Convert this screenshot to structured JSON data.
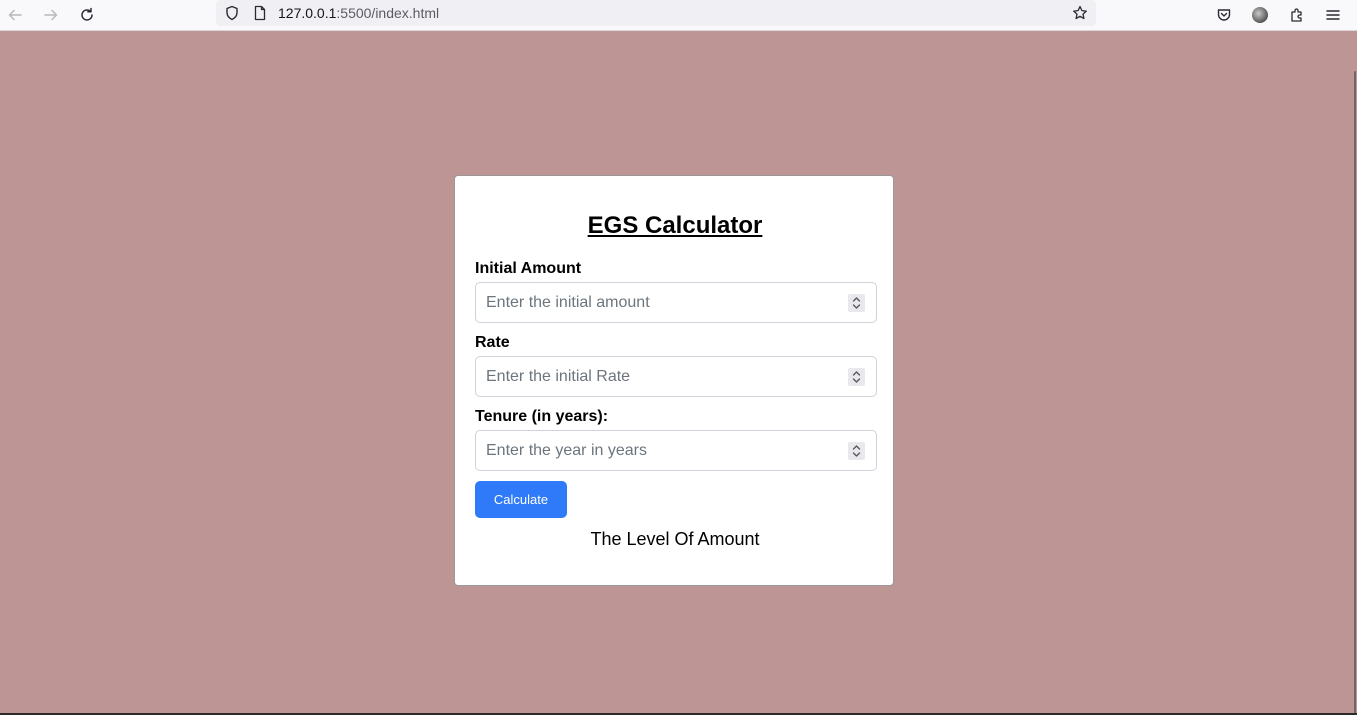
{
  "browser": {
    "url_host": "127.0.0.1",
    "url_rest": ":5500/index.html"
  },
  "calculator": {
    "title": "EGS Calculator",
    "initial_amount": {
      "label": "Initial Amount",
      "placeholder": "Enter the initial amount",
      "value": ""
    },
    "rate": {
      "label": "Rate",
      "placeholder": "Enter the initial Rate",
      "value": ""
    },
    "tenure": {
      "label": "Tenure (in years):",
      "placeholder": "Enter the year in years",
      "value": ""
    },
    "calculate_label": "Calculate",
    "result_text": "The Level Of Amount"
  },
  "colors": {
    "page_background": "#bc9594",
    "button": "#2f7af8"
  },
  "icons": [
    "back-arrow-icon",
    "forward-arrow-icon",
    "reload-icon",
    "shield-icon",
    "page-icon",
    "bookmark-star-icon",
    "pocket-icon",
    "account-avatar-icon",
    "extensions-icon",
    "menu-icon",
    "spinner-icon"
  ]
}
